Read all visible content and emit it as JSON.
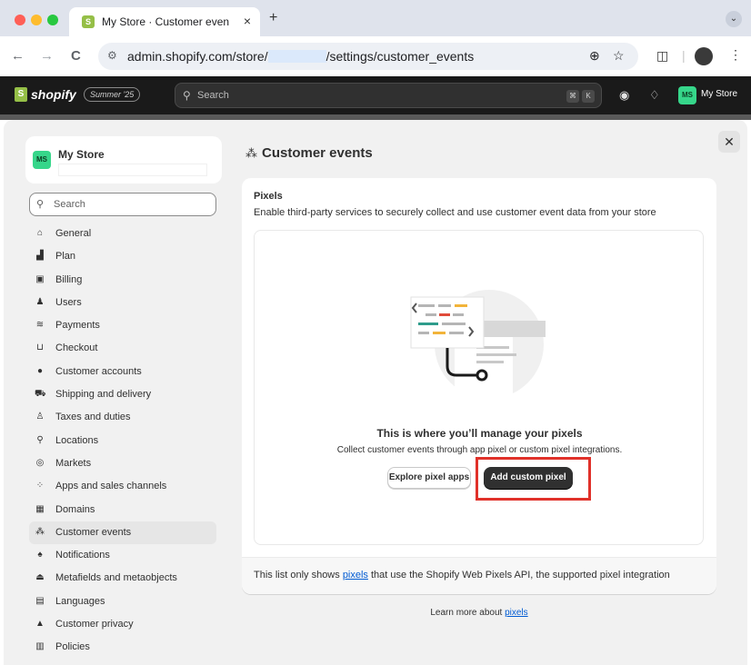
{
  "browser": {
    "tab_title": "My Store · Customer events ·",
    "tab_close": "×",
    "new_tab": "+",
    "tab_menu": "⌄",
    "url_prefix": "admin.shopify.com/store/",
    "url_suffix": "/settings/customer_events",
    "back": "←",
    "forward": "→",
    "reload": "C"
  },
  "topbar": {
    "brand": "shopify",
    "season_badge": "Summer '25",
    "search_placeholder": "Search",
    "shortcut_keys": [
      "⌘",
      "K"
    ],
    "store_initials": "MS",
    "store_name": "My Store"
  },
  "sidebar": {
    "store_initials": "MS",
    "store_name": "My Store",
    "search_placeholder": "Search",
    "items": [
      {
        "label": "General",
        "icon": "store-icon",
        "glyph": "⌂"
      },
      {
        "label": "Plan",
        "icon": "plan-icon",
        "glyph": "▟"
      },
      {
        "label": "Billing",
        "icon": "billing-icon",
        "glyph": "▣"
      },
      {
        "label": "Users",
        "icon": "users-icon",
        "glyph": "♟"
      },
      {
        "label": "Payments",
        "icon": "payments-icon",
        "glyph": "≋"
      },
      {
        "label": "Checkout",
        "icon": "cart-icon",
        "glyph": "⊔"
      },
      {
        "label": "Customer accounts",
        "icon": "person-icon",
        "glyph": "●"
      },
      {
        "label": "Shipping and delivery",
        "icon": "truck-icon",
        "glyph": "⛟"
      },
      {
        "label": "Taxes and duties",
        "icon": "taxes-icon",
        "glyph": "♙"
      },
      {
        "label": "Locations",
        "icon": "location-icon",
        "glyph": "⚲"
      },
      {
        "label": "Markets",
        "icon": "globe-icon",
        "glyph": "◎"
      },
      {
        "label": "Apps and sales channels",
        "icon": "apps-icon",
        "glyph": "⁘"
      },
      {
        "label": "Domains",
        "icon": "domains-icon",
        "glyph": "▦"
      },
      {
        "label": "Customer events",
        "icon": "customer-events-icon",
        "glyph": "⁂",
        "active": true
      },
      {
        "label": "Notifications",
        "icon": "bell-icon",
        "glyph": "♠"
      },
      {
        "label": "Metafields and metaobjects",
        "icon": "metafields-icon",
        "glyph": "⏏"
      },
      {
        "label": "Languages",
        "icon": "languages-icon",
        "glyph": "▤"
      },
      {
        "label": "Customer privacy",
        "icon": "lock-icon",
        "glyph": "▲"
      },
      {
        "label": "Policies",
        "icon": "policies-icon",
        "glyph": "▥"
      }
    ]
  },
  "main": {
    "title": "Customer events",
    "card_title": "Pixels",
    "card_subtitle": "Enable third-party services to securely collect and use customer event data from your store",
    "empty_heading": "This is where you’ll manage your pixels",
    "empty_description": "Collect customer events through app pixel or custom pixel integrations.",
    "explore_button": "Explore pixel apps",
    "add_button": "Add custom pixel",
    "footer_prefix": "This list only shows ",
    "footer_link": "pixels",
    "footer_suffix": " that use the Shopify Web Pixels API, the supported pixel integration",
    "learn_prefix": "Learn more about ",
    "learn_link": "pixels"
  },
  "colors": {
    "accent_green": "#36d68a",
    "shopify_green": "#95bf47",
    "highlight_red": "#e0312a",
    "link_blue": "#005bd3",
    "primary_button": "#303030"
  }
}
